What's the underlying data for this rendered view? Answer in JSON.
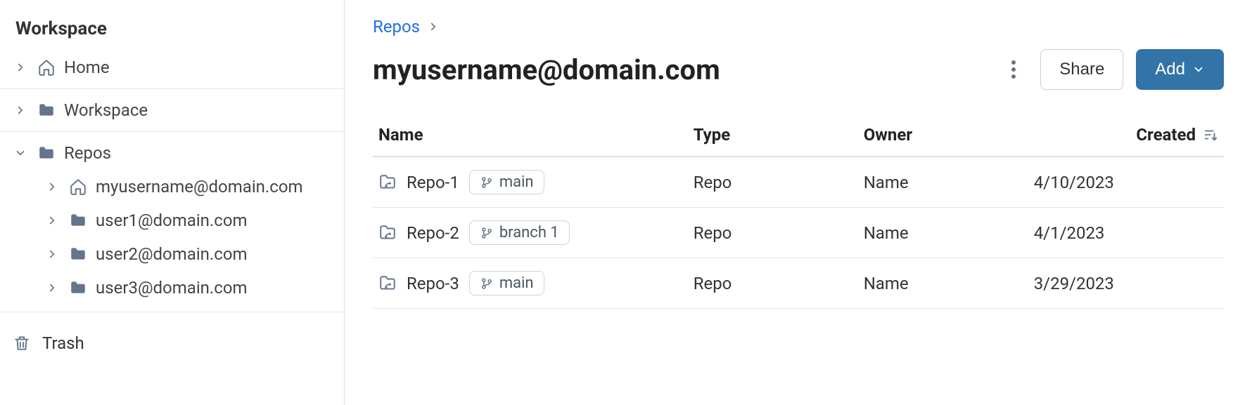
{
  "sidebar": {
    "heading": "Workspace",
    "home_label": "Home",
    "workspace_label": "Workspace",
    "repos_label": "Repos",
    "repo_users": [
      {
        "label": "myusername@domain.com",
        "icon": "home"
      },
      {
        "label": "user1@domain.com",
        "icon": "folder"
      },
      {
        "label": "user2@domain.com",
        "icon": "folder"
      },
      {
        "label": "user3@domain.com",
        "icon": "folder"
      }
    ],
    "trash_label": "Trash"
  },
  "breadcrumb": {
    "item": "Repos"
  },
  "header": {
    "title": "myusername@domain.com",
    "share_label": "Share",
    "add_label": "Add"
  },
  "table": {
    "columns": {
      "name": "Name",
      "type": "Type",
      "owner": "Owner",
      "created": "Created"
    },
    "rows": [
      {
        "name": "Repo-1",
        "branch": "main",
        "type": "Repo",
        "owner": "Name",
        "created": "4/10/2023"
      },
      {
        "name": "Repo-2",
        "branch": "branch 1",
        "type": "Repo",
        "owner": "Name",
        "created": "4/1/2023"
      },
      {
        "name": "Repo-3",
        "branch": "main",
        "type": "Repo",
        "owner": "Name",
        "created": "3/29/2023"
      }
    ]
  }
}
